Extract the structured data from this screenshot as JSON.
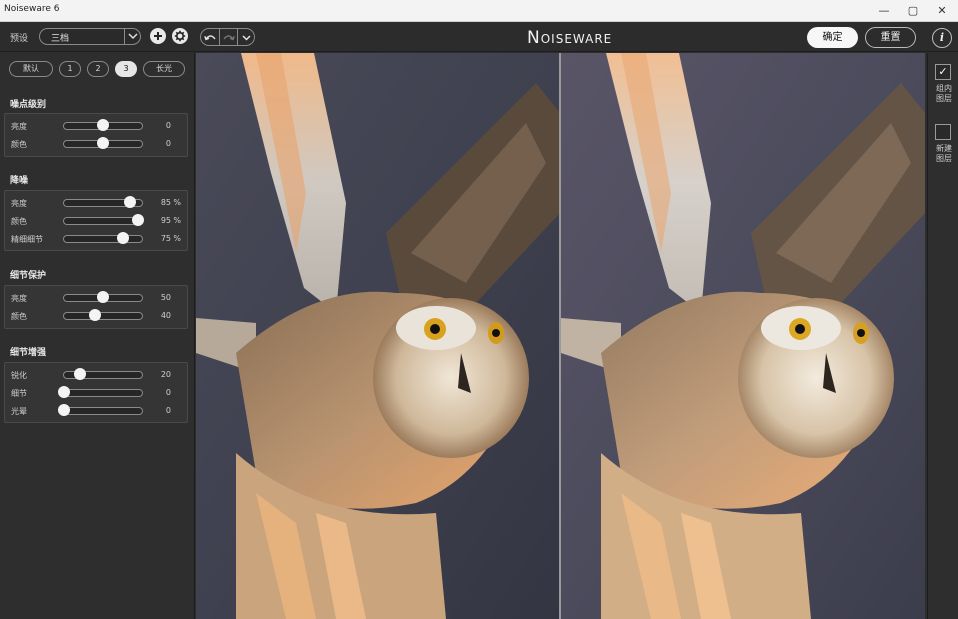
{
  "window": {
    "title": "Noiseware 6"
  },
  "toolbar": {
    "preset_label": "预设",
    "preset_value": "三档",
    "brand": "Noiseware",
    "ok_label": "确定",
    "reset_label": "重置",
    "info_label": "i"
  },
  "levels": {
    "items": [
      {
        "label": "默认",
        "active": false
      },
      {
        "label": "1",
        "active": false
      },
      {
        "label": "2",
        "active": false
      },
      {
        "label": "3",
        "active": true
      },
      {
        "label": "长光",
        "active": false
      }
    ]
  },
  "sections": [
    {
      "title": "噪点级别",
      "rows": [
        {
          "label": "亮度",
          "value": "0",
          "unit": "",
          "level": 0.5
        },
        {
          "label": "颜色",
          "value": "0",
          "unit": "",
          "level": 0.5
        }
      ]
    },
    {
      "title": "降噪",
      "rows": [
        {
          "label": "亮度",
          "value": "85",
          "unit": "%",
          "level": 0.85
        },
        {
          "label": "颜色",
          "value": "95",
          "unit": "%",
          "level": 0.95
        },
        {
          "label": "精细细节",
          "value": "75",
          "unit": "%",
          "level": 0.75
        }
      ]
    },
    {
      "title": "细节保护",
      "rows": [
        {
          "label": "亮度",
          "value": "50",
          "unit": "",
          "level": 0.5
        },
        {
          "label": "颜色",
          "value": "40",
          "unit": "",
          "level": 0.4
        }
      ]
    },
    {
      "title": "细节增强",
      "rows": [
        {
          "label": "锐化",
          "value": "20",
          "unit": "",
          "level": 0.2
        },
        {
          "label": "细节",
          "value": "0",
          "unit": "",
          "level": 0
        },
        {
          "label": "光晕",
          "value": "0",
          "unit": "",
          "level": 0
        }
      ]
    }
  ],
  "layers": {
    "group_label": "组内图层",
    "new_label": "新建图层",
    "group_checked": true,
    "new_checked": false
  },
  "colors": {
    "accent": "#f7f7f7",
    "panel": "#2e2e2e",
    "background": "#2b2b2b"
  }
}
